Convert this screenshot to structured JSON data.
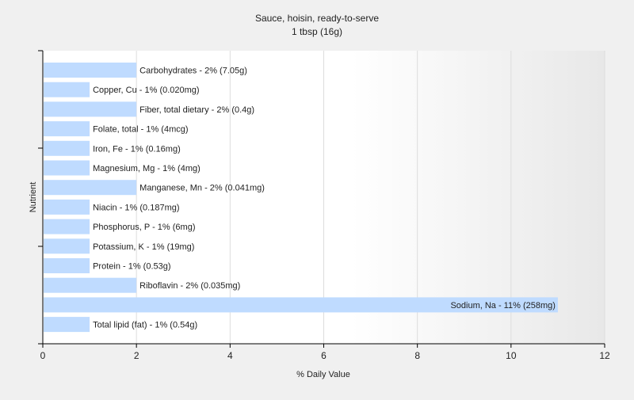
{
  "chart_data": {
    "type": "bar",
    "orientation": "horizontal",
    "title": "Sauce, hoisin, ready-to-serve",
    "subtitle": "1 tbsp (16g)",
    "xlabel": "% Daily Value",
    "ylabel": "Nutrient",
    "xlim": [
      0,
      12
    ],
    "xticks": [
      0,
      2,
      4,
      6,
      8,
      10,
      12
    ],
    "grid": true,
    "bar_color": "#bfdbff",
    "categories": [
      "Carbohydrates",
      "Copper, Cu",
      "Fiber, total dietary",
      "Folate, total",
      "Iron, Fe",
      "Magnesium, Mg",
      "Manganese, Mn",
      "Niacin",
      "Phosphorus, P",
      "Potassium, K",
      "Protein",
      "Riboflavin",
      "Sodium, Na",
      "Total lipid (fat)"
    ],
    "values": [
      2,
      1,
      2,
      1,
      1,
      1,
      2,
      1,
      1,
      1,
      1,
      2,
      11,
      1
    ],
    "data_labels": [
      "Carbohydrates - 2% (7.05g)",
      "Copper, Cu - 1% (0.020mg)",
      "Fiber, total dietary - 2% (0.4g)",
      "Folate, total - 1% (4mcg)",
      "Iron, Fe - 1% (0.16mg)",
      "Magnesium, Mg - 1% (4mg)",
      "Manganese, Mn - 2% (0.041mg)",
      "Niacin - 1% (0.187mg)",
      "Phosphorus, P - 1% (6mg)",
      "Potassium, K - 1% (19mg)",
      "Protein - 1% (0.53g)",
      "Riboflavin - 2% (0.035mg)",
      "Sodium, Na - 11% (258mg)",
      "Total lipid (fat) - 1% (0.54g)"
    ]
  }
}
